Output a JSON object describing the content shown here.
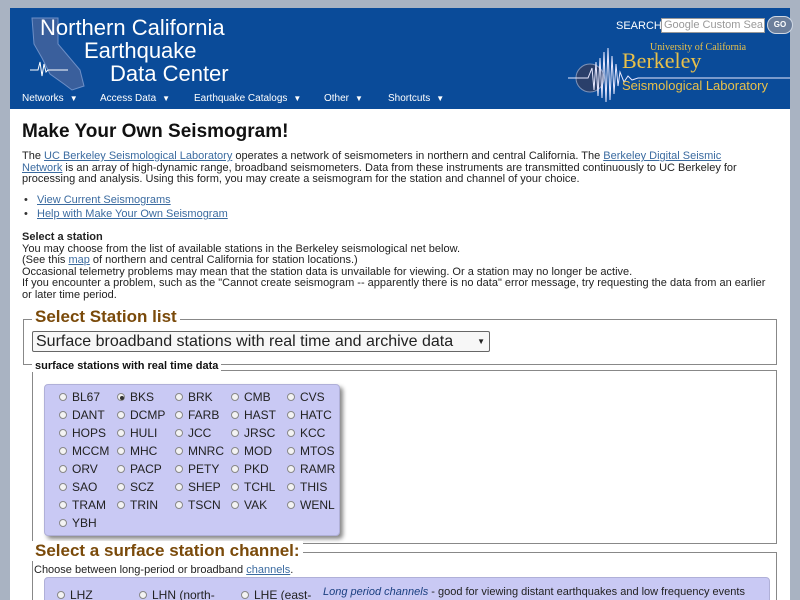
{
  "header": {
    "title_line1": "Northern California",
    "title_line2": "Earthquake",
    "title_line3": "Data Center",
    "search_label": "SEARCH",
    "search_placeholder": "Google Custom Sea",
    "go_label": "GO",
    "uc_text": "University of California",
    "berkeley_text": "Berkeley",
    "lab_text": "Seismological Laboratory",
    "accent_color": "#0a4b99",
    "logo_color": "#e8c04a"
  },
  "nav": [
    {
      "label": "Networks"
    },
    {
      "label": "Access Data"
    },
    {
      "label": "Earthquake Catalogs"
    },
    {
      "label": "Other"
    },
    {
      "label": "Shortcuts"
    }
  ],
  "page": {
    "title": "Make Your Own Seismogram!",
    "intro_pre": "The ",
    "intro_link1": "UC Berkeley Seismological Laboratory",
    "intro_mid": " operates a network of seismometers in northern and central California. The ",
    "intro_link2": "Berkeley Digital Seismic Network",
    "intro_post": " is an array of high-dynamic range, broadband seismometers. Data from these instruments are transmitted continuously to UC Berkeley for processing and analysis. Using this form, you may create a seismogram for the station and channel of your choice.",
    "links": [
      "View Current Seismograms",
      "Help with Make Your Own Seismogram"
    ],
    "select_heading": "Select a station",
    "select_line1": "You may choose from the list of available stations in the Berkeley seismological net below.",
    "select_line2_pre": "(See this ",
    "select_line2_link": "map",
    "select_line2_post": " of northern and central California for station locations.)",
    "select_line3": "Occasional telemetry problems may mean that the station data is unvailable for viewing. Or a station may no longer be active.",
    "select_line4": "If you encounter a problem, such as the \"Cannot create seismogram -- apparently there is no data\" error message, try requesting the data from an earlier or later time period."
  },
  "station_list": {
    "legend": "Select Station list",
    "selected": "Surface broadband stations with real time and archive data"
  },
  "surface_stations": {
    "legend": "surface stations with real time data",
    "selected": "BKS",
    "rows": [
      [
        "BL67",
        "BKS",
        "BRK",
        "CMB",
        "CVS"
      ],
      [
        "DANT",
        "DCMP",
        "FARB",
        "HAST",
        "HATC"
      ],
      [
        "HOPS",
        "HULI",
        "JCC",
        "JRSC",
        "KCC"
      ],
      [
        "MCCM",
        "MHC",
        "MNRC",
        "MOD",
        "MTOS"
      ],
      [
        "ORV",
        "PACP",
        "PETY",
        "PKD",
        "RAMR"
      ],
      [
        "SAO",
        "SCZ",
        "SHEP",
        "TCHL",
        "THIS"
      ],
      [
        "TRAM",
        "TRIN",
        "TSCN",
        "VAK",
        "WENL"
      ],
      [
        "YBH"
      ]
    ]
  },
  "channel": {
    "legend": "Select a surface station channel:",
    "desc_pre": "Choose between long-period or broadband ",
    "desc_link": "channels",
    "desc_post": ".",
    "options": [
      "LHZ",
      "LHN (north-",
      "LHE (east-"
    ],
    "note_italic": "Long period channels",
    "note_rest": " - good for viewing distant earthquakes and low frequency events"
  }
}
